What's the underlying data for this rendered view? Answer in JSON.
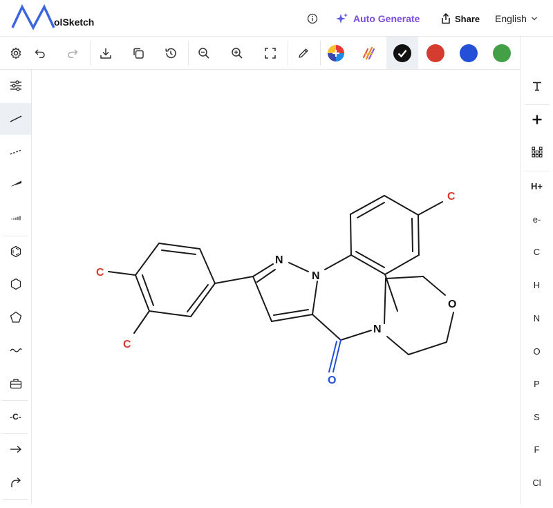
{
  "app": {
    "logo_text": "olSketch"
  },
  "header": {
    "auto_generate": "Auto Generate",
    "share": "Share",
    "language": "English"
  },
  "colors": {
    "accent_purple": "#7c4ddb",
    "black": "#111111",
    "red": "#d63b30",
    "blue": "#2350d6",
    "green": "#43a047"
  },
  "toolbar": {
    "icons": [
      "gear-icon",
      "undo-icon",
      "redo-icon",
      "download-icon",
      "copy-icon",
      "history-icon",
      "zoom-out-icon",
      "zoom-in-icon",
      "fit-screen-icon",
      "pencil-icon",
      "color-picker-icon",
      "ai-style-icon"
    ],
    "selected_color": "black"
  },
  "left_tools": [
    "settings-sliders",
    "single-bond",
    "dashed-bond",
    "wedge-bond",
    "hashed-bond",
    "benzene-ring",
    "cyclohexane-ring",
    "cyclopentane-ring",
    "chain",
    "template-toolbox",
    "chain-group",
    "reaction-arrow",
    "curved-arrow"
  ],
  "left_chain_label": "-C-",
  "right_tools": {
    "h_plus": "H+",
    "e_minus": "e-",
    "elements": [
      "C",
      "H",
      "N",
      "O",
      "P",
      "S",
      "F",
      "Cl"
    ]
  },
  "molecule": {
    "atoms": [
      {
        "label": "C",
        "color": "#d63b30"
      },
      {
        "label": "C",
        "color": "#d63b30"
      },
      {
        "label": "N",
        "color": "#111111"
      },
      {
        "label": "N",
        "color": "#111111"
      },
      {
        "label": "C",
        "color": "#d63b30"
      },
      {
        "label": "O",
        "color": "#111111"
      },
      {
        "label": "N",
        "color": "#111111"
      },
      {
        "label": "O",
        "color": "#2350d6"
      }
    ]
  }
}
